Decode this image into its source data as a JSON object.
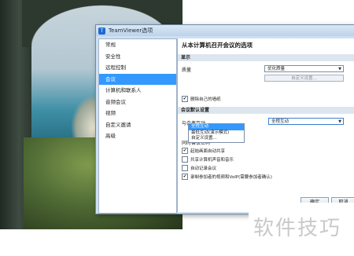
{
  "window": {
    "title": "TeamViewer选项",
    "app_icon_glyph": "T"
  },
  "sidebar": {
    "items": [
      {
        "label": "常规"
      },
      {
        "label": "安全性"
      },
      {
        "label": "远程控制"
      },
      {
        "label": "会议"
      },
      {
        "label": "计算机和联系人"
      },
      {
        "label": "音频会议"
      },
      {
        "label": "视频"
      },
      {
        "label": "自定义邀请"
      },
      {
        "label": "高级"
      }
    ],
    "selected_index": 3
  },
  "content": {
    "heading": "从本计算机召开会议的选项",
    "display_section": "显示",
    "quality_label": "质量",
    "quality_value": "优化质量",
    "custom_settings_button": "自定义设置...",
    "remove_wallpaper": {
      "label": "删除自己的墙纸",
      "checked": true
    },
    "defaults_section": "会议默认设置",
    "interaction_label": "与会者互动",
    "interaction_value": "全程互动",
    "interaction_options": [
      "全程互动",
      "最低互动(演示模式)",
      "自定义设置..."
    ],
    "interaction_highlight_index": 0,
    "password_label": "同时会议密码",
    "options": [
      {
        "label": "起始画面自动共享",
        "checked": true
      },
      {
        "label": "共享计算机声音和音乐",
        "checked": false
      },
      {
        "label": "自动记录会议",
        "checked": false
      },
      {
        "label": "录制参加者的视频和VoIP(需要参加者确认)",
        "checked": true
      }
    ]
  },
  "footer": {
    "ok_label": "确定",
    "cancel_label": "取消"
  },
  "watermark": {
    "text": "软件技巧"
  },
  "colors": {
    "selected": "#3399ff",
    "section_bg": "#dde6ef"
  }
}
